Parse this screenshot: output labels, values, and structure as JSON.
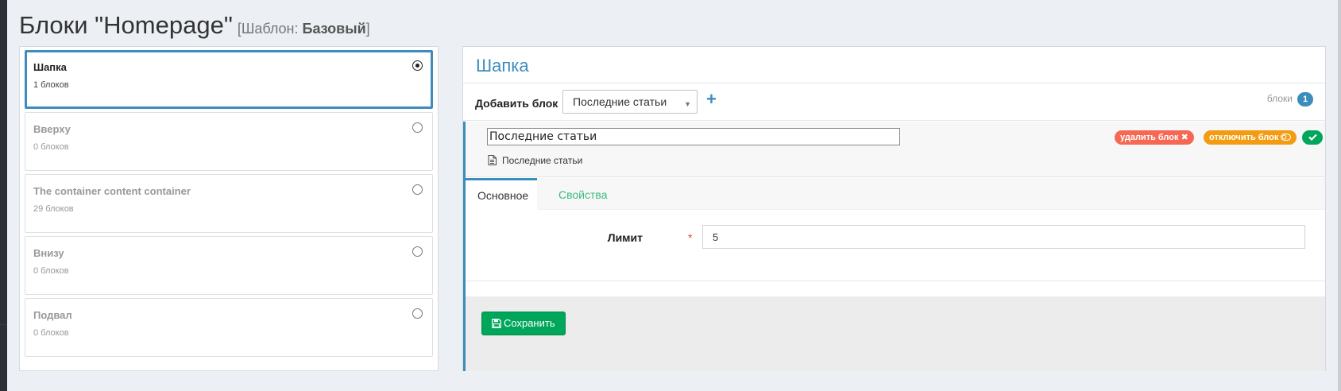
{
  "header": {
    "title": "Блоки \"Homepage\"",
    "template_prefix": "[Шаблон: ",
    "template_name": "Базовый",
    "template_suffix": "]"
  },
  "zones": [
    {
      "name": "Шапка",
      "count": "1 блоков",
      "active": true
    },
    {
      "name": "Вверху",
      "count": "0 блоков",
      "active": false
    },
    {
      "name": "The container content container",
      "count": "29 блоков",
      "active": false
    },
    {
      "name": "Внизу",
      "count": "0 блоков",
      "active": false
    },
    {
      "name": "Подвал",
      "count": "0 блоков",
      "active": false
    }
  ],
  "panel": {
    "title": "Шапка",
    "add_label": "Добавить блок",
    "add_select_value": "Последние статьи",
    "blocks_label": "блоки",
    "blocks_count": "1"
  },
  "block": {
    "name_value": "Последние статьи",
    "type_label": "Последние статьи",
    "delete_label": "удалить блок",
    "disable_label": "отключить блок",
    "tabs": {
      "main": "Основное",
      "props": "Свойства"
    },
    "limit_label": "Лимит",
    "limit_required": "*",
    "limit_value": "5",
    "save_label": "Сохранить"
  },
  "colors": {
    "accent": "#3c8dbc",
    "success": "#00a65a",
    "danger": "#f56954",
    "warning": "#f39c12"
  }
}
